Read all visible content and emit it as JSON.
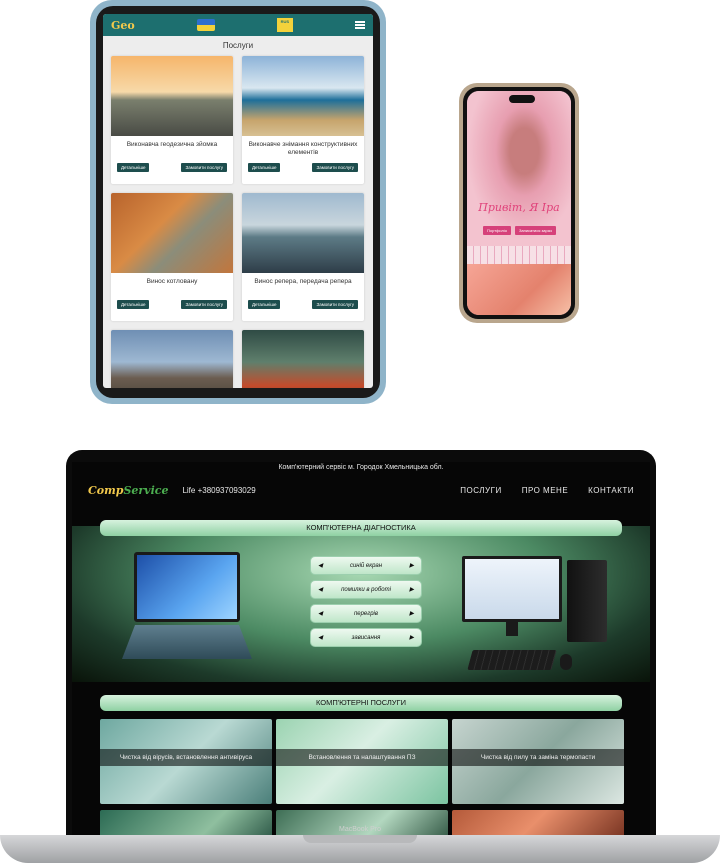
{
  "tablet": {
    "header": {
      "logo": "Geo",
      "lang_badge": "RUS"
    },
    "heading": "Послуги",
    "buttons": {
      "details": "Детальніше",
      "order": "Замовити послугу"
    },
    "cards": [
      {
        "title": "Виконавча геодезична зйомка"
      },
      {
        "title": "Виконавче знімання конструктивних елементів"
      },
      {
        "title": "Винос котловану"
      },
      {
        "title": "Винос репера, передача репера"
      },
      {
        "title": ""
      },
      {
        "title": ""
      }
    ]
  },
  "phone": {
    "hero_title": "Привіт, Я Іра",
    "buttons": [
      "Портфоліо",
      "Записатися зараз"
    ]
  },
  "laptop": {
    "model": "MacBook Pro",
    "site": {
      "topbar": "Комп'ютерний сервіс м. Городок Хмельницька обл.",
      "logo_main": "Comp",
      "logo_accent": "Service",
      "phone": "Life +380937093029",
      "menu": [
        "ПОСЛУГИ",
        "ПРО МЕНЕ",
        "КОНТАКТИ"
      ],
      "diagnostics_band": "КОМП'ЮТЕРНА ДІАГНОСТИКА",
      "diagnostics": [
        "синій екран",
        "помилки в роботі",
        "перегрів",
        "зависання"
      ],
      "services_band": "КОМП'ЮТЕРНІ ПОСЛУГИ",
      "services": [
        "Чистка від вірусів, встановлення антивіруса",
        "Встановлення та налаштування ПЗ",
        "Чистка від пилу та заміна термопасти",
        "",
        "",
        ""
      ]
    }
  }
}
